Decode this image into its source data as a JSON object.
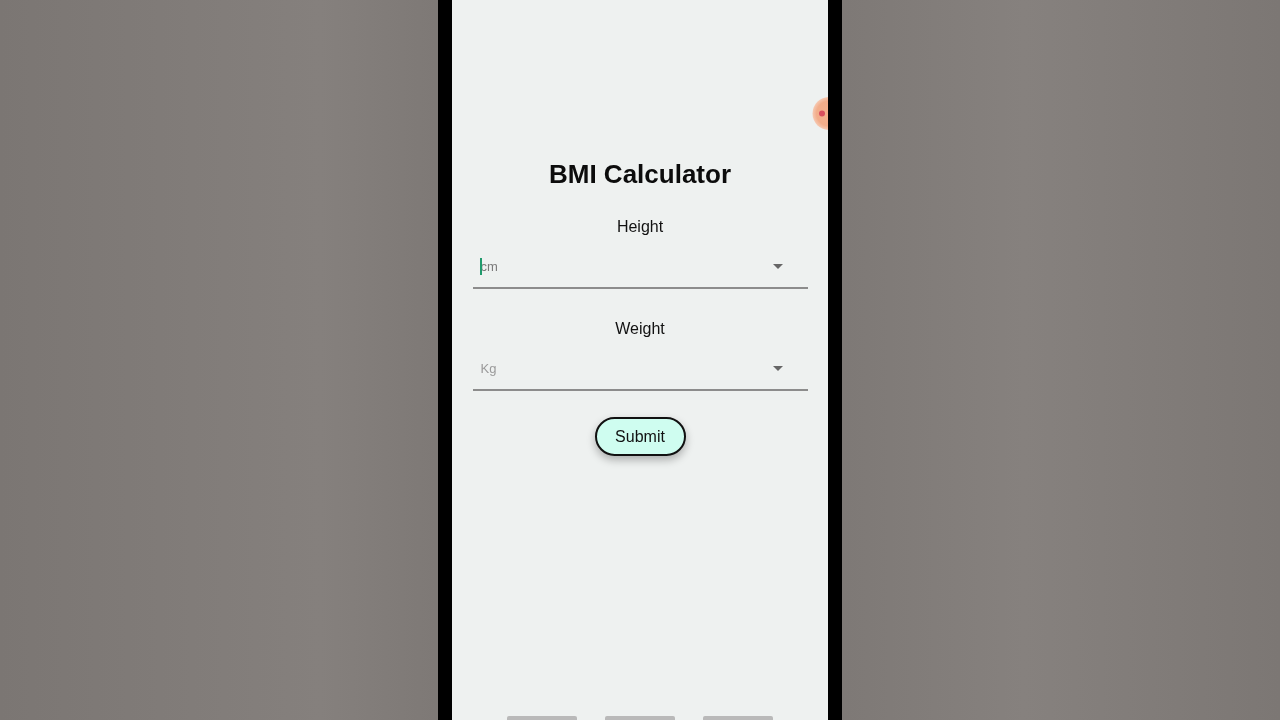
{
  "screen": {
    "title": "BMI Calculator"
  },
  "fields": [
    {
      "label": "Height",
      "placeholder": "cm",
      "focused": true
    },
    {
      "label": "Weight",
      "placeholder": "Kg",
      "focused": false
    }
  ],
  "submit_button": {
    "label": "Submit"
  }
}
